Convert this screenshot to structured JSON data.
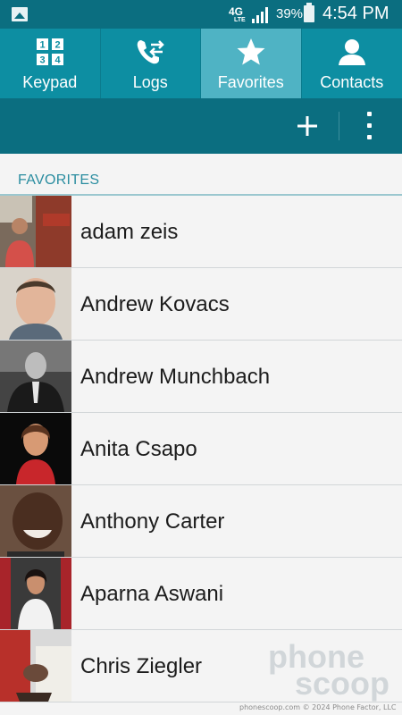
{
  "status_bar": {
    "network": "4G",
    "network_sub": "LTE",
    "battery_percent": "39%",
    "time": "4:54 PM",
    "icons": [
      "image-icon",
      "signal-icon",
      "battery-icon"
    ]
  },
  "tabs": [
    {
      "label": "Keypad",
      "icon": "keypad-icon",
      "active": false
    },
    {
      "label": "Logs",
      "icon": "logs-icon",
      "active": false
    },
    {
      "label": "Favorites",
      "icon": "star-icon",
      "active": true
    },
    {
      "label": "Contacts",
      "icon": "person-icon",
      "active": false
    }
  ],
  "action_bar": {
    "add_icon": "plus-icon",
    "more_icon": "more-vertical-icon"
  },
  "section": {
    "title": "FAVORITES"
  },
  "contacts": [
    {
      "name": "adam zeis"
    },
    {
      "name": "Andrew Kovacs"
    },
    {
      "name": "Andrew Munchbach"
    },
    {
      "name": "Anita Csapo"
    },
    {
      "name": "Anthony Carter"
    },
    {
      "name": "Aparna Aswani"
    },
    {
      "name": "Chris Ziegler"
    }
  ],
  "watermark": {
    "line1": "phone",
    "line2": "scoop"
  },
  "footer": {
    "credit": "phonescoop.com  © 2024 Phone Factor, LLC"
  },
  "colors": {
    "status_bar": "#0b6e80",
    "tab_bar": "#0d8ea2",
    "tab_active": "#4fb3c4",
    "section_title": "#2a8da0",
    "background": "#f4f4f4"
  }
}
